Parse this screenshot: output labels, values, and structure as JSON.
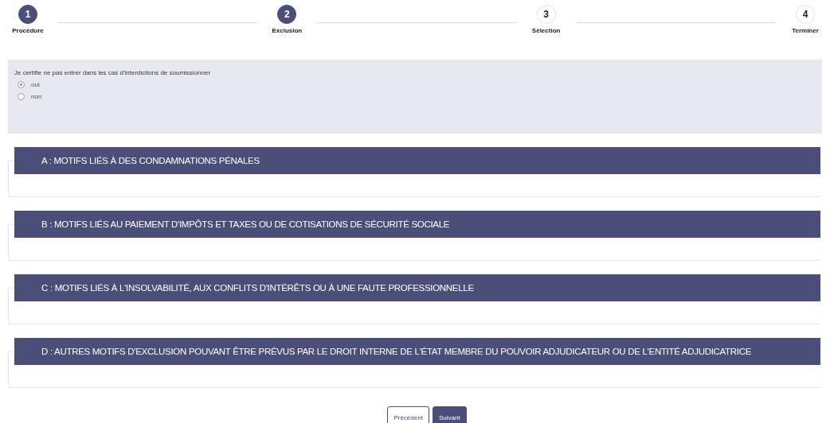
{
  "steps": [
    {
      "number": "1",
      "label": "Procédure",
      "active": true
    },
    {
      "number": "2",
      "label": "Exclusion",
      "active": true
    },
    {
      "number": "3",
      "label": "Sélection",
      "active": false
    },
    {
      "number": "4",
      "label": "Terminer",
      "active": false
    }
  ],
  "question": {
    "label": "Je certifie ne pas entrer dans les cas d'interdictions de soumissionner",
    "options": [
      {
        "label": "oui",
        "selected": true
      },
      {
        "label": "non",
        "selected": false
      }
    ]
  },
  "sections": [
    {
      "title": "A : MOTIFS LIÉS À DES CONDAMNATIONS PÉNALES"
    },
    {
      "title": "B : MOTIFS LIÉS AU PAIEMENT D'IMPÔTS ET TAXES OU DE COTISATIONS DE SÉCURITÉ SOCIALE"
    },
    {
      "title": "C : MOTIFS LIÉS À L'INSOLVABILITÉ, AUX CONFLITS D'INTÉRÊTS OU À UNE FAUTE PROFESSIONNELLE"
    },
    {
      "title": "D : AUTRES MOTIFS D'EXCLUSION POUVANT ÊTRE PRÉVUS PAR LE DROIT INTERNE DE L'ÉTAT MEMBRE DU POUVOIR ADJUDICATEUR OU DE L'ENTITÉ ADJUDICATRICE"
    }
  ],
  "buttons": [
    {
      "label": "Précédent",
      "kind": "secondary"
    },
    {
      "label": "Suivant",
      "kind": "primary"
    }
  ]
}
